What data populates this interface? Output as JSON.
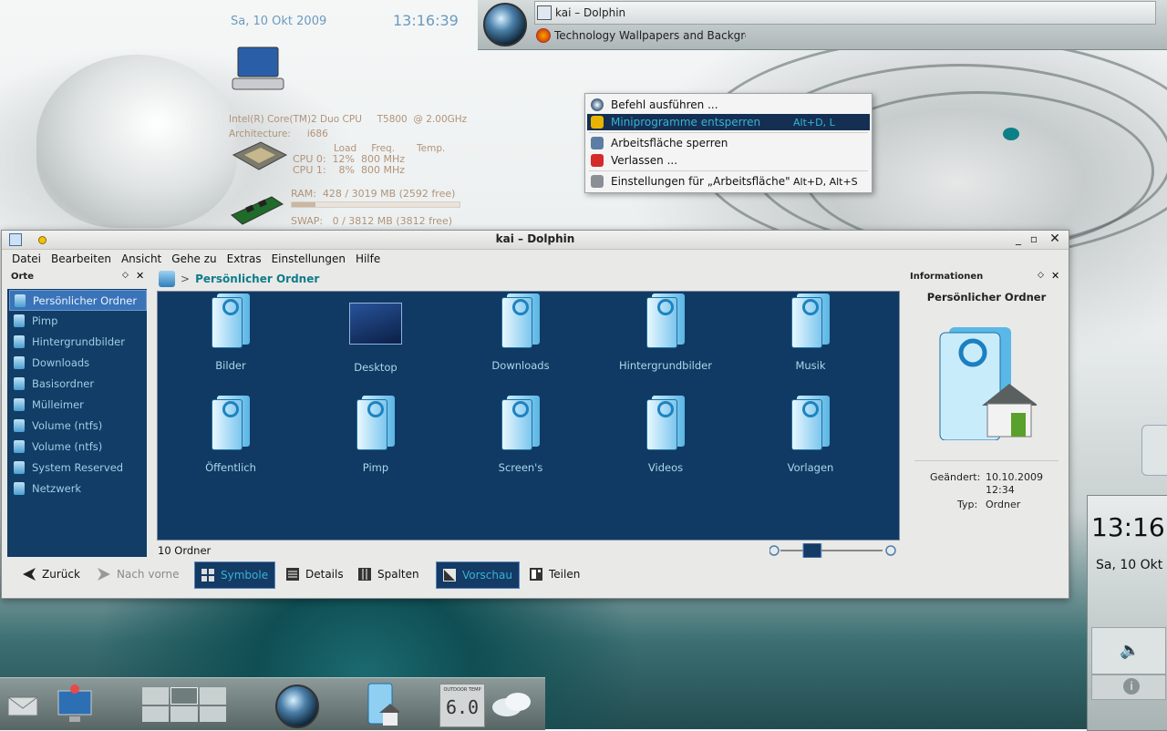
{
  "desktop_clock": {
    "date": "Sa, 10 Okt 2009",
    "time": "13:16:39"
  },
  "sysinfo": {
    "cpu_model": "Intel(R) Core(TM)2 Duo CPU     T5800  @ 2.00GHz",
    "arch_label": "Architecture:",
    "arch_value": "i686",
    "col_load": "Load",
    "col_freq": "Freq.",
    "col_temp": "Temp.",
    "cpu0": "CPU 0:  12%  800 MHz",
    "cpu1": "CPU 1:    8%  800 MHz",
    "ram": "RAM:  428 / 3019 MB (2592 free)",
    "swap": "SWAP:   0 / 3812 MB (3812 free)",
    "ram_fraction": 0.14,
    "swap_fraction": 0.0
  },
  "taskbar": {
    "tasks": [
      {
        "label": "kai – Dolphin",
        "icon": "dolphin-icon"
      },
      {
        "label": "Technology Wallpapers and Backgrou",
        "icon": "firefox-icon"
      }
    ]
  },
  "context_menu": {
    "items": [
      {
        "label": "Befehl ausführen ...",
        "shortcut": "",
        "icon": "run-command-icon",
        "highlighted": false
      },
      {
        "label": "Miniprogramme entsperren",
        "shortcut": "Alt+D, L",
        "icon": "unlock-icon",
        "highlighted": true
      },
      {
        "label": "Arbeitsfläche sperren",
        "shortcut": "",
        "icon": "lock-screen-icon",
        "highlighted": false
      },
      {
        "label": "Verlassen ...",
        "shortcut": "",
        "icon": "power-icon",
        "highlighted": false
      },
      {
        "label": "Einstellungen für „Arbeitsfläche\"",
        "shortcut": "Alt+D, Alt+S",
        "icon": "wrench-icon",
        "highlighted": false
      }
    ]
  },
  "window": {
    "title": "kai – Dolphin",
    "menu": [
      "Datei",
      "Bearbeiten",
      "Ansicht",
      "Gehe zu",
      "Extras",
      "Einstellungen",
      "Hilfe"
    ]
  },
  "places": {
    "title": "Orte",
    "items": [
      {
        "label": "Persönlicher Ordner",
        "selected": true
      },
      {
        "label": "Pimp",
        "selected": false
      },
      {
        "label": "Hintergrundbilder",
        "selected": false
      },
      {
        "label": "Downloads",
        "selected": false
      },
      {
        "label": "Basisordner",
        "selected": false
      },
      {
        "label": "Mülleimer",
        "selected": false
      },
      {
        "label": "Volume (ntfs)",
        "selected": false
      },
      {
        "label": "Volume (ntfs)",
        "selected": false
      },
      {
        "label": "System Reserved",
        "selected": false
      },
      {
        "label": "Netzwerk",
        "selected": false
      }
    ]
  },
  "breadcrumb": {
    "separator": ">",
    "current": "Persönlicher Ordner"
  },
  "files": [
    {
      "name": "Bilder",
      "kind": "folder"
    },
    {
      "name": "Desktop",
      "kind": "desktop"
    },
    {
      "name": "Downloads",
      "kind": "folder"
    },
    {
      "name": "Hintergrundbilder",
      "kind": "folder"
    },
    {
      "name": "Musik",
      "kind": "folder"
    },
    {
      "name": "Öffentlich",
      "kind": "folder"
    },
    {
      "name": "Pimp",
      "kind": "folder"
    },
    {
      "name": "Screen's",
      "kind": "folder"
    },
    {
      "name": "Videos",
      "kind": "folder"
    },
    {
      "name": "Vorlagen",
      "kind": "folder"
    }
  ],
  "status": {
    "count": "10 Ordner",
    "zoom_fraction": 0.27
  },
  "info_panel": {
    "header": "Informationen",
    "title": "Persönlicher Ordner",
    "modified_label": "Geändert:",
    "modified_date": "10.10.2009",
    "modified_time": "12:34",
    "type_label": "Typ:",
    "type_value": "Ordner"
  },
  "toolbar": {
    "back": "Zurück",
    "forward": "Nach vorne",
    "icons": "Symbole",
    "details": "Details",
    "columns": "Spalten",
    "preview": "Vorschau",
    "split": "Teilen"
  },
  "dock": {
    "outdoor_label": "OUTDOOR TEMP",
    "outdoor_value": "6.0"
  },
  "right_clock": {
    "time": "13:16",
    "date": "Sa, 10 Okt"
  }
}
